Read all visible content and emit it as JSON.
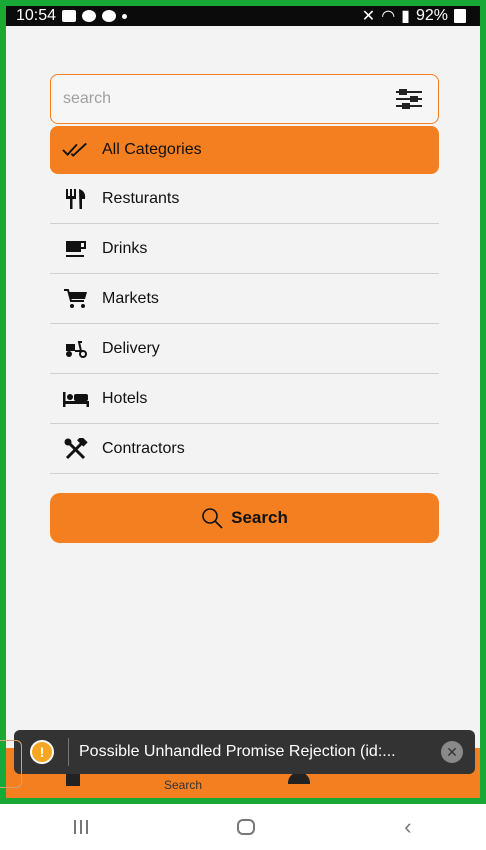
{
  "status_bar": {
    "time": "10:54",
    "battery": "92%"
  },
  "search": {
    "placeholder": "search"
  },
  "categories": [
    {
      "label": "All Categories",
      "icon": "double-check-icon",
      "active": true
    },
    {
      "label": "Resturants",
      "icon": "fork-knife-icon",
      "active": false
    },
    {
      "label": "Drinks",
      "icon": "coffee-cup-icon",
      "active": false
    },
    {
      "label": "Markets",
      "icon": "shopping-cart-icon",
      "active": false
    },
    {
      "label": "Delivery",
      "icon": "scooter-icon",
      "active": false
    },
    {
      "label": "Hotels",
      "icon": "bed-icon",
      "active": false
    },
    {
      "label": "Contractors",
      "icon": "tools-icon",
      "active": false
    }
  ],
  "search_button": {
    "label": "Search"
  },
  "bottom_tab": {
    "active_label": "Search"
  },
  "toast": {
    "message": "Possible Unhandled Promise Rejection (id:..."
  },
  "colors": {
    "accent": "#f47f20",
    "frame": "#17a836",
    "toast_bg": "#333333"
  }
}
